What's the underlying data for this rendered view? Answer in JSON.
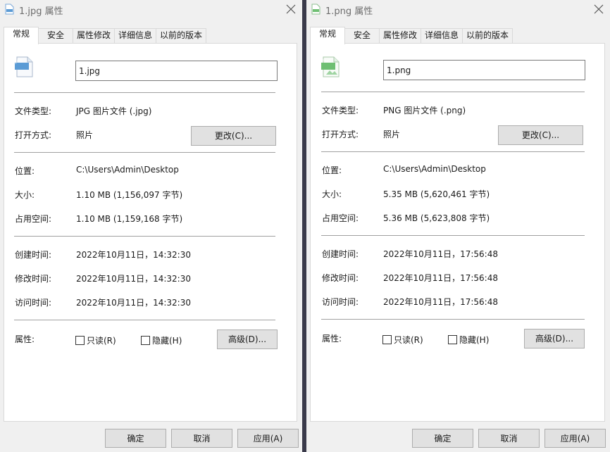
{
  "left": {
    "title": "1.jpg 属性",
    "icon_badge": "JPG",
    "tabs": [
      "常规",
      "安全",
      "属性修改",
      "详细信息",
      "以前的版本"
    ],
    "filename": "1.jpg",
    "labels": {
      "type": "文件类型:",
      "open_with": "打开方式:",
      "location": "位置:",
      "size": "大小:",
      "size_on_disk": "占用空间:",
      "created": "创建时间:",
      "modified": "修改时间:",
      "accessed": "访问时间:",
      "attributes": "属性:"
    },
    "values": {
      "type": "JPG 图片文件 (.jpg)",
      "open_with": "照片",
      "location": "C:\\Users\\Admin\\Desktop",
      "size": "1.10 MB (1,156,097 字节)",
      "size_on_disk": "1.10 MB (1,159,168 字节)",
      "created": "2022年10月11日，14:32:30",
      "modified": "2022年10月11日，14:32:30",
      "accessed": "2022年10月11日，14:32:30"
    },
    "change_button": "更改(C)...",
    "readonly_label": "只读(R)",
    "hidden_label": "隐藏(H)",
    "advanced_button": "高级(D)...",
    "ok_button": "确定",
    "cancel_button": "取消",
    "apply_button": "应用(A)"
  },
  "right": {
    "title": "1.png 属性",
    "icon_badge": "PNG",
    "tabs": [
      "常规",
      "安全",
      "属性修改",
      "详细信息",
      "以前的版本"
    ],
    "filename": "1.png",
    "labels": {
      "type": "文件类型:",
      "open_with": "打开方式:",
      "location": "位置:",
      "size": "大小:",
      "size_on_disk": "占用空间:",
      "created": "创建时间:",
      "modified": "修改时间:",
      "accessed": "访问时间:",
      "attributes": "属性:"
    },
    "values": {
      "type": "PNG 图片文件 (.png)",
      "open_with": "照片",
      "location": "C:\\Users\\Admin\\Desktop",
      "size": "5.35 MB (5,620,461 字节)",
      "size_on_disk": "5.36 MB (5,623,808 字节)",
      "created": "2022年10月11日，17:56:48",
      "modified": "2022年10月11日，17:56:48",
      "accessed": "2022年10月11日，17:56:48"
    },
    "change_button": "更改(C)...",
    "readonly_label": "只读(R)",
    "hidden_label": "隐藏(H)",
    "advanced_button": "高级(D)...",
    "ok_button": "确定",
    "cancel_button": "取消",
    "apply_button": "应用(A)"
  },
  "colors": {
    "jpg_icon": "#5b9bd5",
    "png_icon": "#6fbf73",
    "window_bg": "#f0f0f0",
    "panel_bg": "#ffffff"
  }
}
